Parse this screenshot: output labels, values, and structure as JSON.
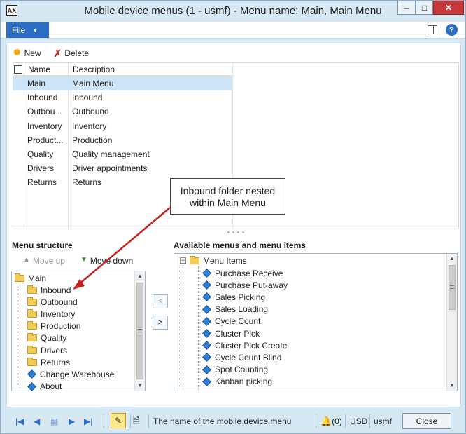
{
  "window": {
    "title": "Mobile device menus (1 - usmf) - Menu name: Main, Main Menu",
    "app_icon_label": "AX",
    "controls": {
      "minimize": "–",
      "maximize": "□",
      "close": "✕"
    }
  },
  "ribbon": {
    "file_label": "File",
    "help_label": "?"
  },
  "toolbar": {
    "new_label": "New",
    "delete_label": "Delete"
  },
  "grid": {
    "columns": [
      "Name",
      "Description"
    ],
    "rows": [
      {
        "name": "Main",
        "description": "Main Menu",
        "selected": true
      },
      {
        "name": "Inbound",
        "description": "Inbound"
      },
      {
        "name": "Outbou...",
        "description": "Outbound"
      },
      {
        "name": "Inventory",
        "description": "Inventory"
      },
      {
        "name": "Product...",
        "description": "Production"
      },
      {
        "name": "Quality",
        "description": "Quality management"
      },
      {
        "name": "Drivers",
        "description": "Driver appointments"
      },
      {
        "name": "Returns",
        "description": "Returns"
      }
    ]
  },
  "callout": {
    "text_line1": "Inbound folder nested",
    "text_line2": "within Main Menu"
  },
  "menu_structure": {
    "title": "Menu structure",
    "move_up_label": "Move up",
    "move_down_label": "Move down",
    "root": "Main",
    "items": [
      {
        "label": "Inbound",
        "type": "folder"
      },
      {
        "label": "Outbound",
        "type": "folder"
      },
      {
        "label": "Inventory",
        "type": "folder"
      },
      {
        "label": "Production",
        "type": "folder"
      },
      {
        "label": "Quality",
        "type": "folder"
      },
      {
        "label": "Drivers",
        "type": "folder"
      },
      {
        "label": "Returns",
        "type": "folder"
      },
      {
        "label": "Change Warehouse",
        "type": "item"
      },
      {
        "label": "About",
        "type": "item"
      }
    ]
  },
  "transfer": {
    "remove_label": "<",
    "add_label": ">"
  },
  "available": {
    "title": "Available menus and menu items",
    "root": "Menu Items",
    "root_expander": "−",
    "items": [
      "Purchase Receive",
      "Purchase Put-away",
      "Sales Picking",
      "Sales Loading",
      "Cycle Count",
      "Cluster Pick",
      "Cluster Pick Create",
      "Cycle Count Blind",
      "Spot Counting",
      "Kanban picking"
    ]
  },
  "statusbar": {
    "help_text": "The name of the mobile device menu",
    "notifications": "(0)",
    "currency": "USD",
    "company": "usmf",
    "close_label": "Close"
  },
  "colors": {
    "accent": "#2b6dc4",
    "selection": "#cce4f7",
    "callout_arrow": "#c8201e",
    "frame": "#d6e8f4"
  }
}
